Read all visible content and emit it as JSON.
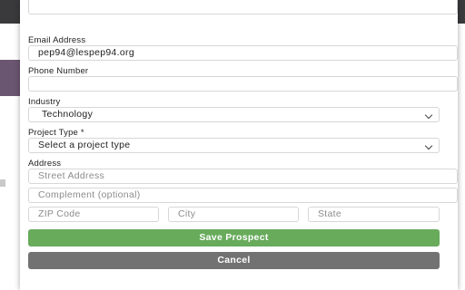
{
  "browser": {
    "star_icon": "star-icon",
    "extension_icon": "extension-icon"
  },
  "form": {
    "email": {
      "label": "Email Address",
      "value": "pep94@lespep94.org"
    },
    "phone": {
      "label": "Phone Number",
      "value": ""
    },
    "industry": {
      "label": "Industry",
      "selected": "Technology"
    },
    "project_type": {
      "label": "Project Type *",
      "selected": "Select a project type"
    },
    "address": {
      "label": "Address",
      "street_placeholder": "Street Address",
      "complement_placeholder": "Complement (optional)",
      "zip_placeholder": "ZIP Code",
      "city_placeholder": "City",
      "state_placeholder": "State"
    },
    "buttons": {
      "save": "Save Prospect",
      "cancel": "Cancel"
    }
  },
  "colors": {
    "save_button": "#67ab5b",
    "cancel_button": "#727272"
  }
}
